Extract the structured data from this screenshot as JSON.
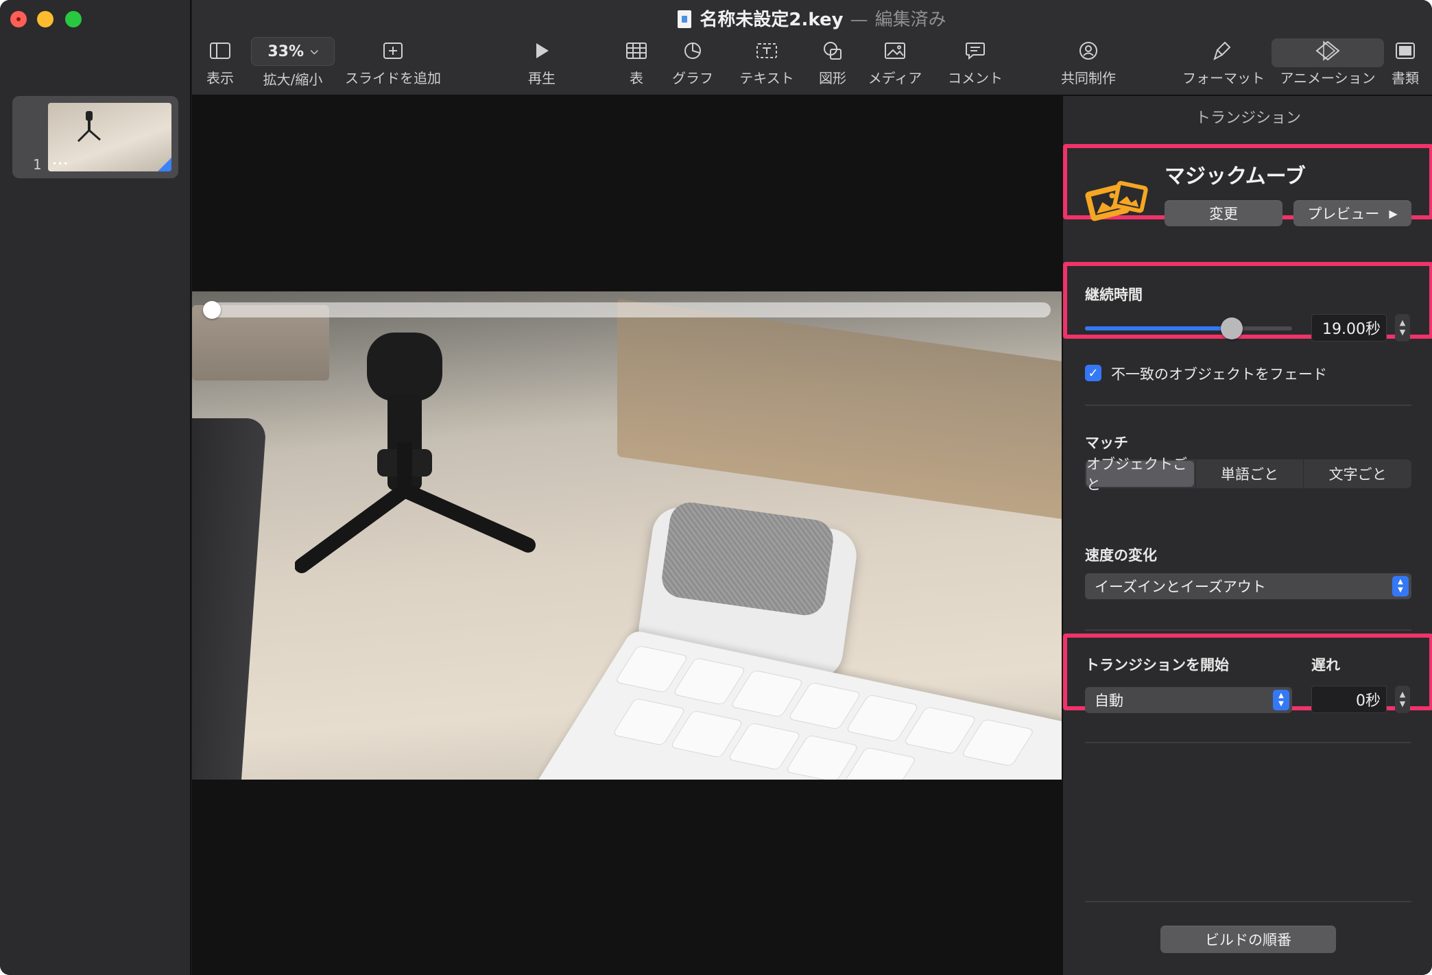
{
  "window": {
    "title": "名称未設定2.key",
    "separator": "—",
    "status": "編集済み"
  },
  "sidebar": {
    "slides": [
      {
        "number": "1",
        "dots": "•••"
      }
    ]
  },
  "toolbar": {
    "view": "表示",
    "zoom_value": "33%",
    "zoom": "拡大/縮小",
    "add_slide": "スライドを追加",
    "play": "再生",
    "table": "表",
    "chart": "グラフ",
    "text": "テキスト",
    "shape": "図形",
    "media": "メディア",
    "comment": "コメント",
    "collaborate": "共同制作",
    "format": "フォーマット",
    "animate": "アニメーション",
    "document": "書類"
  },
  "canvas": {
    "playback_progress": 0.0
  },
  "inspector": {
    "title": "トランジション",
    "transition_name": "マジックムーブ",
    "change_button": "変更",
    "preview_button": "プレビュー",
    "duration_label": "継続時間",
    "duration_value": "19.00秒",
    "duration_slider_fraction": 0.71,
    "fade_checkbox_label": "不一致のオブジェクトをフェード",
    "fade_checked": true,
    "match_label": "マッチ",
    "match_options": [
      "オブジェクトごと",
      "単語ごと",
      "文字ごと"
    ],
    "match_selected": "オブジェクトごと",
    "acceleration_label": "速度の変化",
    "acceleration_value": "イーズインとイーズアウト",
    "start_label": "トランジションを開始",
    "start_value": "自動",
    "delay_label": "遅れ",
    "delay_value": "0秒",
    "build_order_button": "ビルドの順番"
  },
  "colors": {
    "highlight": "#f0336a",
    "accent": "#3478f6",
    "transition_icon": "#f5a623"
  }
}
